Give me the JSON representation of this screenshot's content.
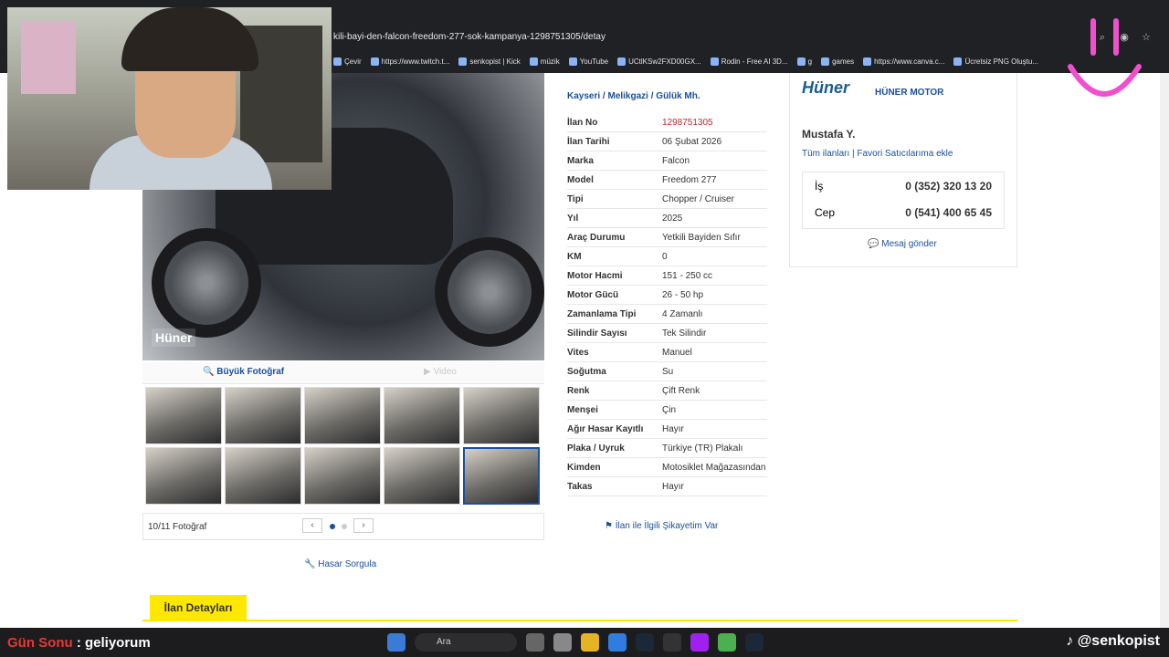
{
  "browser": {
    "url": "kili-bayi-den-falcon-freedom-277-sok-kampanya-1298751305/detay",
    "bookmarks": [
      "Çevir",
      "https://www.twitch.t...",
      "senkopist | Kick",
      "müzik",
      "YouTube",
      "UCtlKSw2FXD00GX...",
      "Rodin - Free AI 3D...",
      "g",
      "games",
      "https://www.canva.c...",
      "Ücretsiz PNG Oluştu..."
    ]
  },
  "listing": {
    "breadcrumb": [
      "Kayseri",
      "Melikgazi",
      "Gülük Mh."
    ],
    "specs": [
      {
        "k": "İlan No",
        "v": "1298751305"
      },
      {
        "k": "İlan Tarihi",
        "v": "06 Şubat 2026"
      },
      {
        "k": "Marka",
        "v": "Falcon"
      },
      {
        "k": "Model",
        "v": "Freedom 277"
      },
      {
        "k": "Tipi",
        "v": "Chopper / Cruiser"
      },
      {
        "k": "Yıl",
        "v": "2025"
      },
      {
        "k": "Araç Durumu",
        "v": "Yetkili Bayiden Sıfır"
      },
      {
        "k": "KM",
        "v": "0"
      },
      {
        "k": "Motor Hacmi",
        "v": "151 - 250 cc"
      },
      {
        "k": "Motor Gücü",
        "v": "26 - 50 hp"
      },
      {
        "k": "Zamanlama Tipi",
        "v": "4 Zamanlı"
      },
      {
        "k": "Silindir Sayısı",
        "v": "Tek Silindir"
      },
      {
        "k": "Vites",
        "v": "Manuel"
      },
      {
        "k": "Soğutma",
        "v": "Su"
      },
      {
        "k": "Renk",
        "v": "Çift Renk"
      },
      {
        "k": "Menşei",
        "v": "Çin"
      },
      {
        "k": "Ağır Hasar Kayıtlı",
        "v": "Hayır"
      },
      {
        "k": "Plaka / Uyruk",
        "v": "Türkiye (TR) Plakalı"
      },
      {
        "k": "Kimden",
        "v": "Motosiklet Mağazasından"
      },
      {
        "k": "Takas",
        "v": "Hayır"
      }
    ],
    "complain": "İlan ile İlgili Şikayetim Var"
  },
  "gallery": {
    "big_photo": "Büyük Fotoğraf",
    "video": "Video",
    "count": "10/11 Fotoğraf",
    "photo_logo": "Hüner",
    "hasar": "Hasar Sorgula"
  },
  "seller": {
    "logo": "Hüner",
    "store": "HÜNER MOTOR",
    "owner": "Mustafa Y.",
    "all_ads": "Tüm ilanları",
    "fav": "Favori Satıcılarıma ekle",
    "phones": [
      {
        "label": "İş",
        "number": "0 (352) 320 13 20"
      },
      {
        "label": "Cep",
        "number": "0 (541) 400 65 45"
      }
    ],
    "message": "Mesaj gönder"
  },
  "tabs": {
    "details": "İlan Detayları"
  },
  "overlay": {
    "chat_user": "Gün Sonu",
    "chat_text": ": geliyorum",
    "tiktok": "@senkopist"
  },
  "taskbar": {
    "search": "Ara"
  }
}
